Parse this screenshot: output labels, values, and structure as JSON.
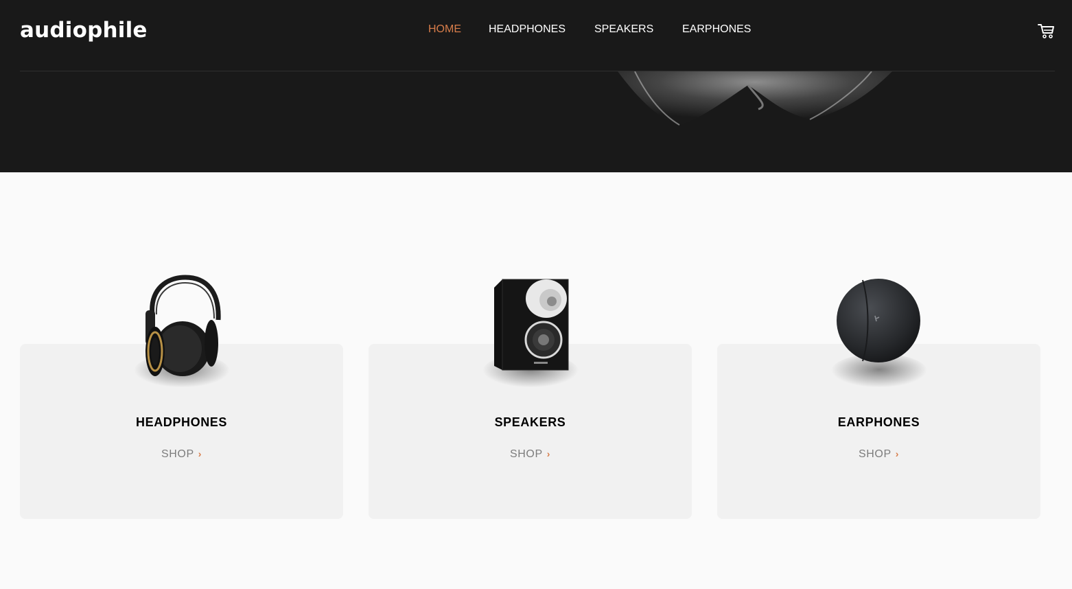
{
  "header": {
    "logo": "audiophile",
    "nav": [
      {
        "label": "HOME",
        "active": true
      },
      {
        "label": "HEADPHONES",
        "active": false
      },
      {
        "label": "SPEAKERS",
        "active": false
      },
      {
        "label": "EARPHONES",
        "active": false
      }
    ],
    "cart_icon": "cart-icon"
  },
  "categories": [
    {
      "title": "HEADPHONES",
      "shop_label": "SHOP",
      "icon": "headphones-image"
    },
    {
      "title": "SPEAKERS",
      "shop_label": "SHOP",
      "icon": "speaker-image"
    },
    {
      "title": "EARPHONES",
      "shop_label": "SHOP",
      "icon": "earphones-case-image"
    }
  ],
  "colors": {
    "accent": "#d87d4a",
    "header_bg": "#191919",
    "page_bg": "#fafafa",
    "card_bg": "#f1f1f1"
  }
}
